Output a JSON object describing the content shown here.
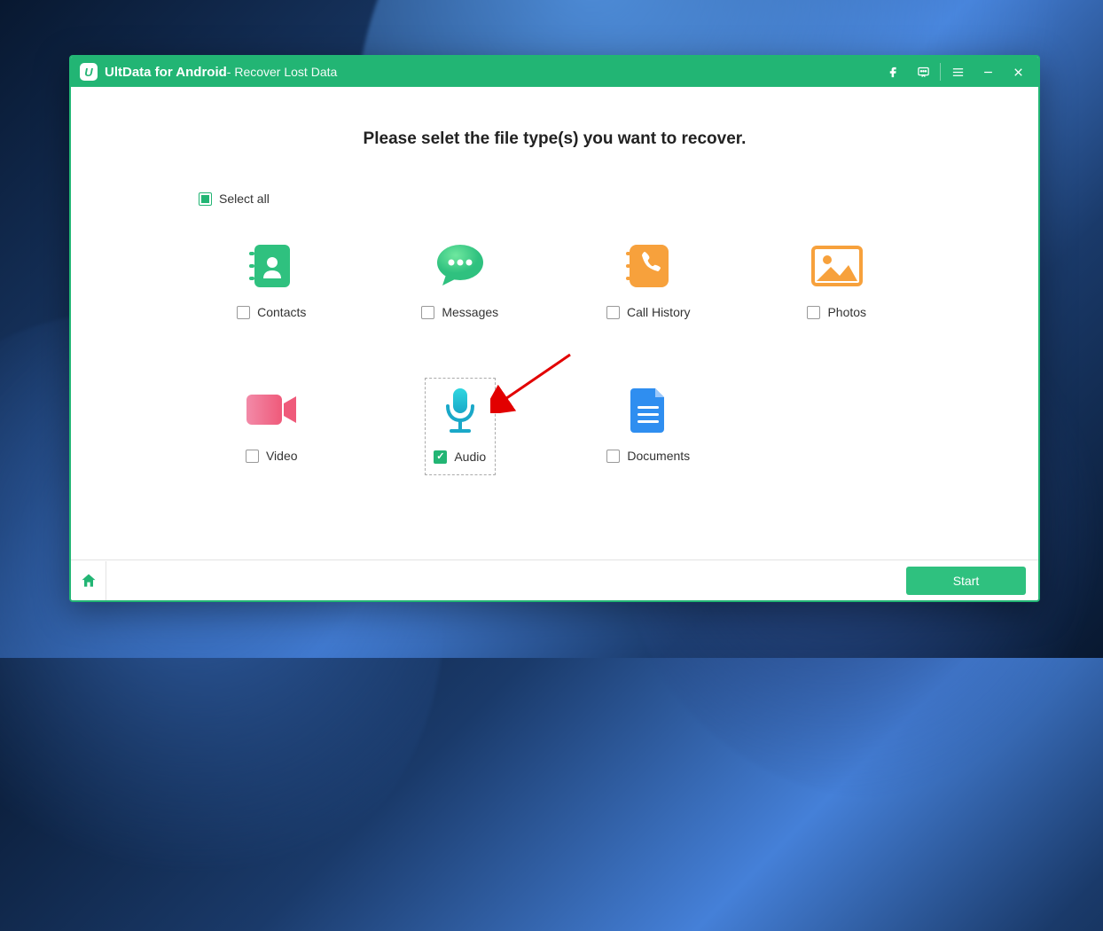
{
  "titlebar": {
    "app_name": "UltData for Android",
    "subtitle": " - Recover Lost Data"
  },
  "heading": "Please selet the file type(s) you want to recover.",
  "select_all_label": "Select all",
  "items": {
    "contacts": "Contacts",
    "messages": "Messages",
    "call_history": "Call History",
    "photos": "Photos",
    "video": "Video",
    "audio": "Audio",
    "documents": "Documents"
  },
  "footer": {
    "start_label": "Start"
  }
}
